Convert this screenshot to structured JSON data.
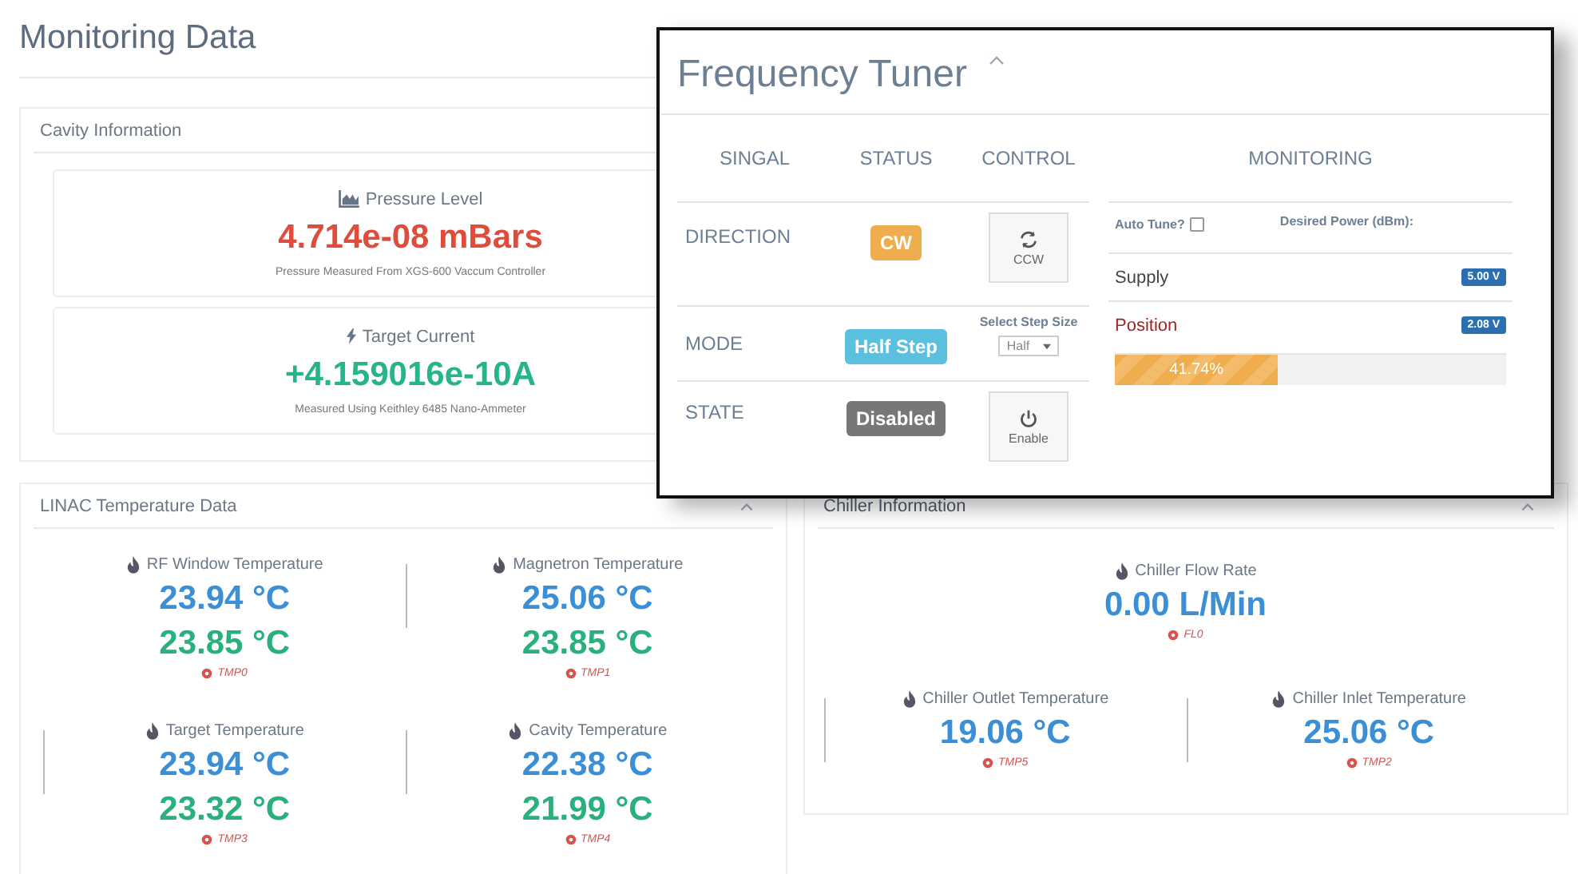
{
  "page": {
    "title": "Monitoring Data"
  },
  "cavity": {
    "title": "Cavity Information",
    "cards": [
      {
        "kind": "pressure",
        "label": "Pressure Level",
        "value": "4.714e-08 mBars",
        "note": "Pressure Measured From XGS-600 Vaccum Controller",
        "color": "#e04c3c"
      },
      {
        "kind": "current",
        "label": "Target Current",
        "value": "+4.159016e-10A",
        "note": "Measured Using Keithley 6485 Nano-Ammeter",
        "color": "#26b48a"
      }
    ]
  },
  "linac": {
    "title": "LINAC Temperature Data",
    "items": [
      {
        "label": "RF Window Temperature",
        "values": [
          "23.94 °C",
          "23.85 °C"
        ],
        "sensor": "TMP0"
      },
      {
        "label": "Magnetron Temperature",
        "values": [
          "25.06 °C",
          "23.85 °C"
        ],
        "sensor": "TMP1"
      },
      {
        "label": "Target Temperature",
        "values": [
          "23.94 °C",
          "23.32 °C"
        ],
        "sensor": "TMP3"
      },
      {
        "label": "Cavity Temperature",
        "values": [
          "22.38 °C",
          "21.99 °C"
        ],
        "sensor": "TMP4"
      }
    ]
  },
  "chiller": {
    "title": "Chiller Information",
    "flow": {
      "label": "Chiller Flow Rate",
      "value": "0.00 L/Min",
      "sensor": "FL0"
    },
    "items": [
      {
        "label": "Chiller Outlet Temperature",
        "value": "19.06 °C",
        "sensor": "TMP5"
      },
      {
        "label": "Chiller Inlet Temperature",
        "value": "25.06 °C",
        "sensor": "TMP2"
      }
    ]
  },
  "tuner": {
    "title": "Frequency Tuner",
    "columns": [
      "SINGAL",
      "STATUS",
      "CONTROL"
    ],
    "rows": [
      {
        "signal": "DIRECTION",
        "status": "CW",
        "color": "#f0ad4e",
        "control": {
          "kind": "direction",
          "label": "CCW"
        }
      },
      {
        "signal": "MODE",
        "status": "Half Step",
        "color": "#5bc0de",
        "control": {
          "kind": "select",
          "label": "Select Step Size",
          "value": "Half"
        }
      },
      {
        "signal": "STATE",
        "status": "Disabled",
        "color": "#777777",
        "control": {
          "kind": "power",
          "label": "Enable"
        }
      }
    ],
    "monitoring": {
      "title": "MONITORING",
      "auto_tune": {
        "label": "Auto Tune?",
        "checked": false
      },
      "desired_power": "Desired Power (dBm):",
      "readings": [
        {
          "label": "Supply",
          "value": "5.00 V",
          "warning": false
        },
        {
          "label": "Position",
          "value": "2.08 V",
          "warning": true
        }
      ],
      "progress": {
        "level": 0.4174,
        "label": "41.74%"
      }
    }
  }
}
